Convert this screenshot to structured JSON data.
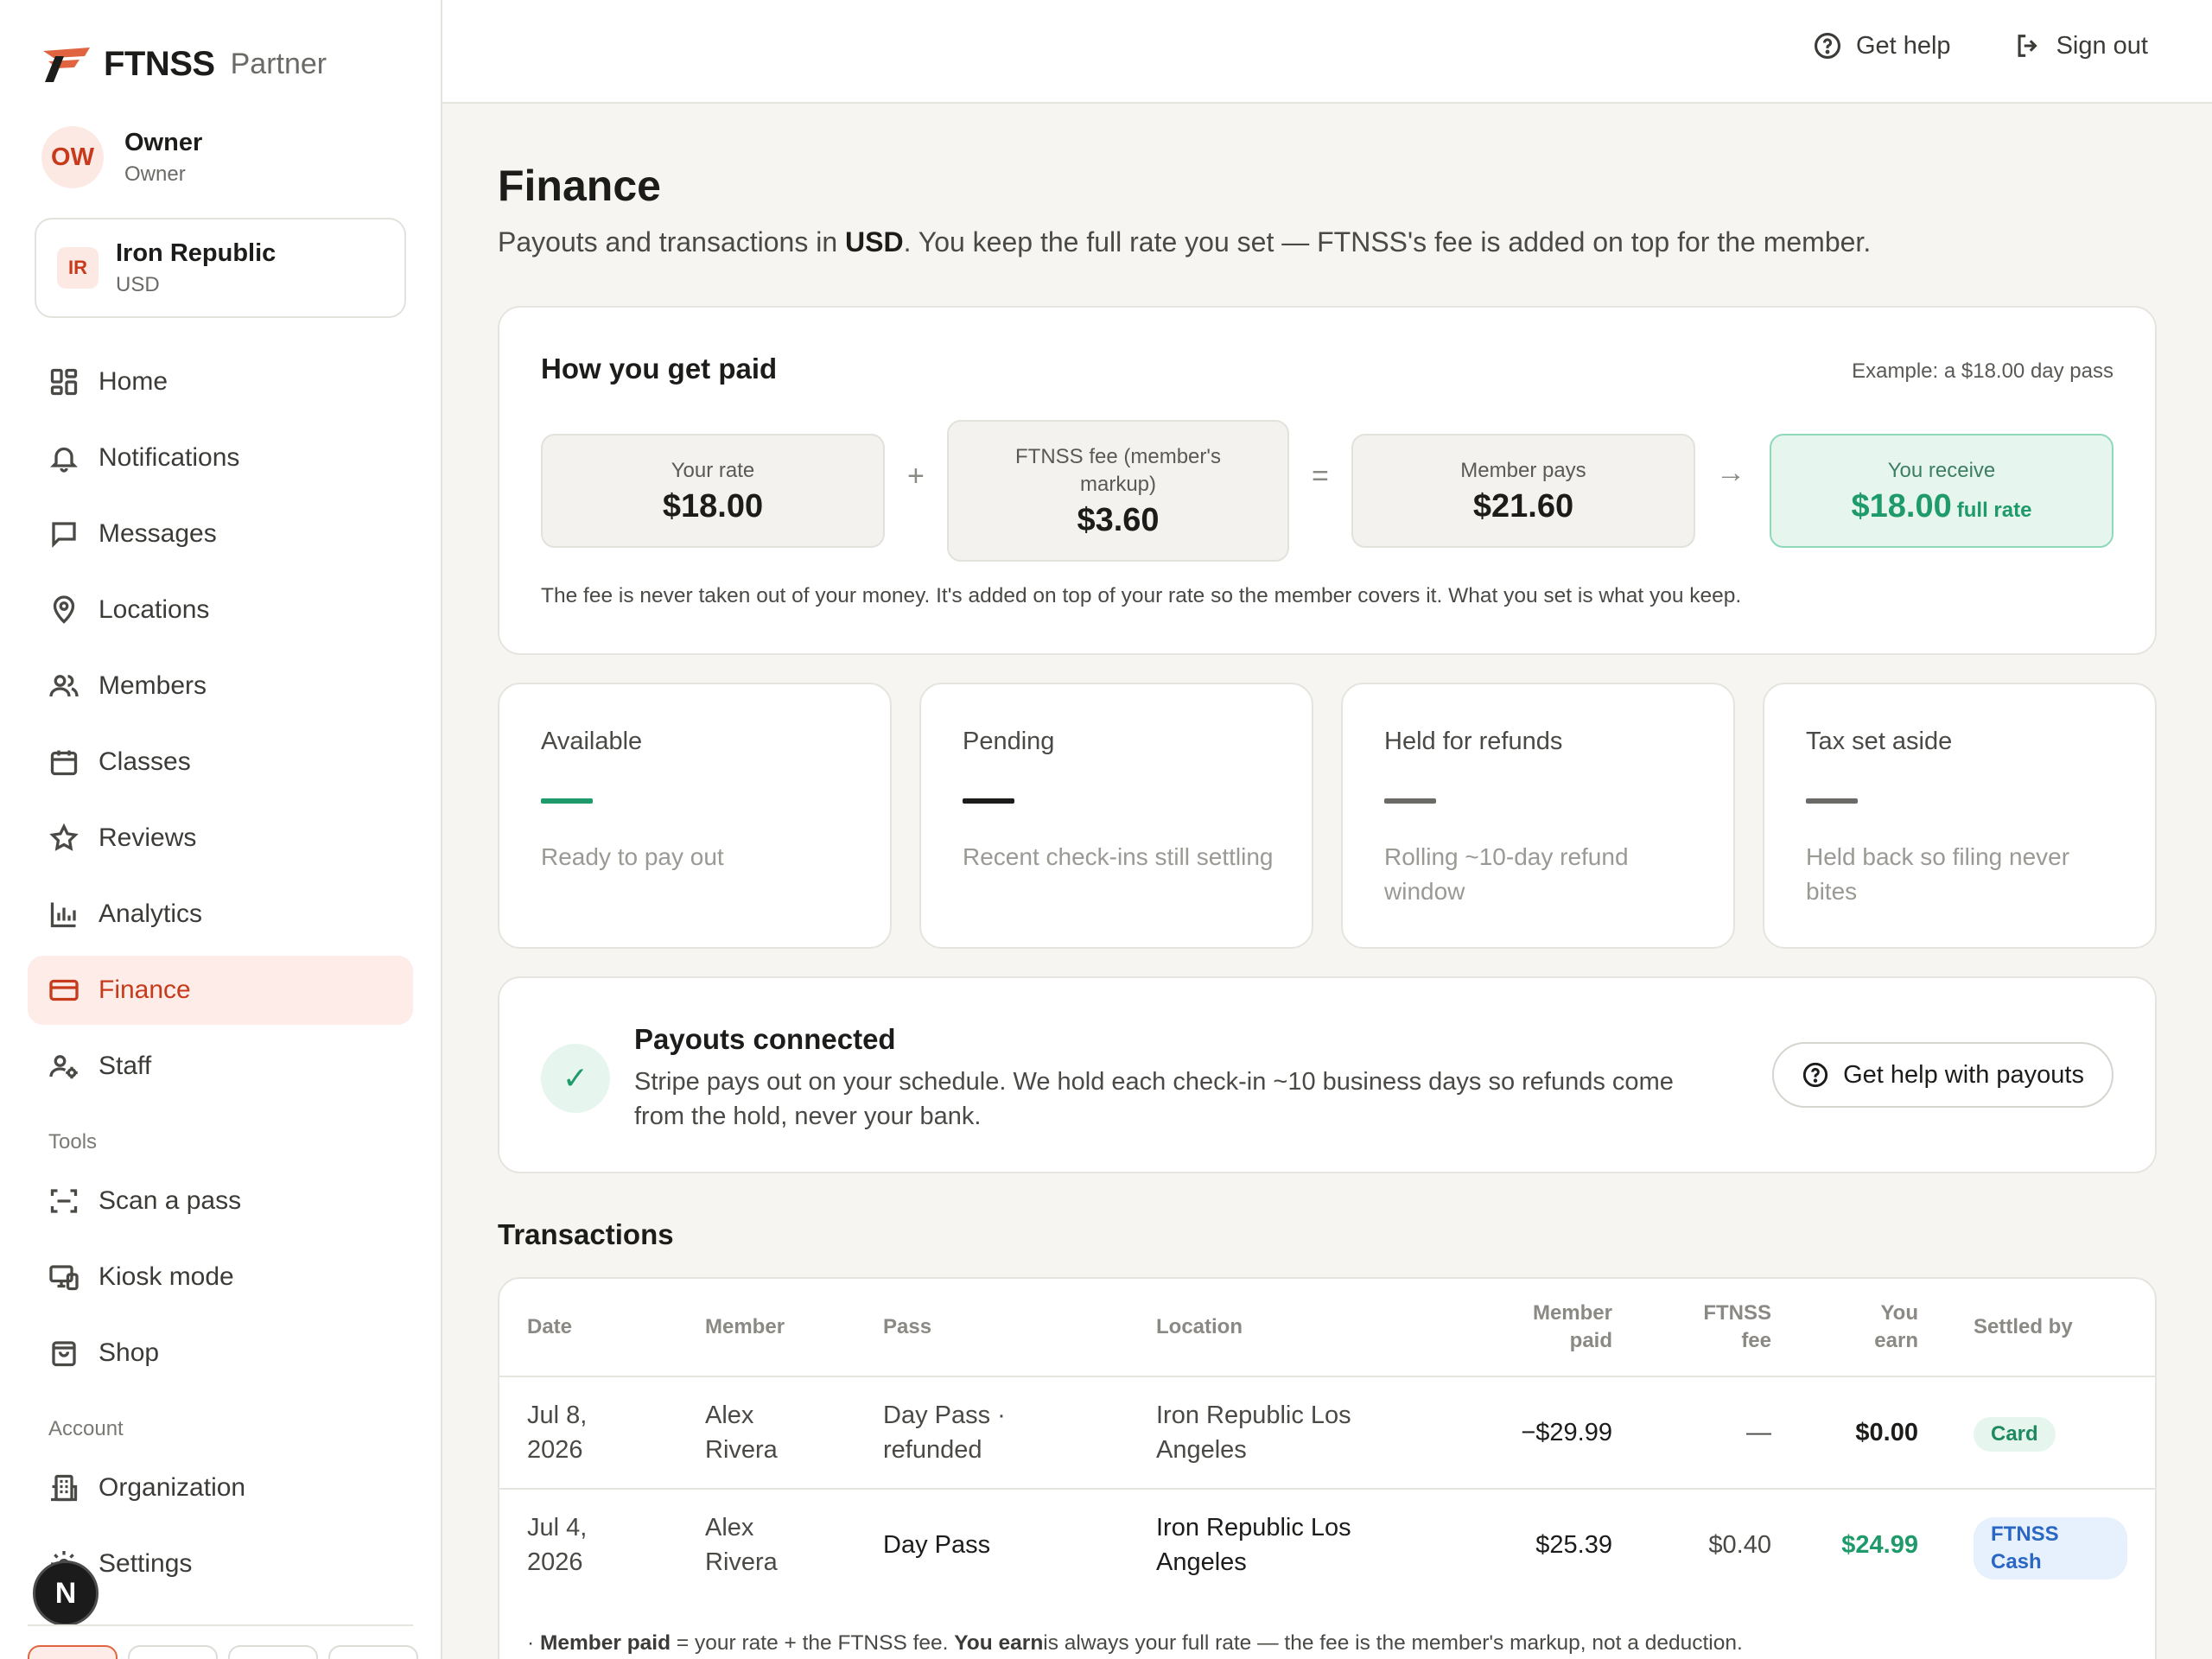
{
  "brand": {
    "name": "FTNSS",
    "sub": "Partner",
    "accent": "#e0643f"
  },
  "user": {
    "initials": "OW",
    "name": "Owner",
    "role": "Owner"
  },
  "org": {
    "initials": "IR",
    "name": "Iron Republic",
    "currency": "USD"
  },
  "nav": {
    "items": [
      {
        "label": "Home",
        "icon": "home-grid-icon"
      },
      {
        "label": "Notifications",
        "icon": "bell-icon"
      },
      {
        "label": "Messages",
        "icon": "message-icon"
      },
      {
        "label": "Locations",
        "icon": "map-pin-icon"
      },
      {
        "label": "Members",
        "icon": "users-icon"
      },
      {
        "label": "Classes",
        "icon": "calendar-icon"
      },
      {
        "label": "Reviews",
        "icon": "star-icon"
      },
      {
        "label": "Analytics",
        "icon": "bar-chart-icon"
      },
      {
        "label": "Finance",
        "icon": "credit-card-icon",
        "active": true
      },
      {
        "label": "Staff",
        "icon": "staff-gear-icon"
      }
    ],
    "tools_label": "Tools",
    "tools": [
      {
        "label": "Scan a pass",
        "icon": "scan-icon"
      },
      {
        "label": "Kiosk mode",
        "icon": "kiosk-icon"
      },
      {
        "label": "Shop",
        "icon": "shopping-bag-icon"
      }
    ],
    "account_label": "Account",
    "account": [
      {
        "label": "Organization",
        "icon": "building-icon"
      },
      {
        "label": "Settings",
        "icon": "settings-icon"
      }
    ],
    "badge": "N"
  },
  "topbar": {
    "help": "Get help",
    "signout": "Sign out"
  },
  "page": {
    "title": "Finance",
    "subtitle_pre": "Payouts and transactions in ",
    "subtitle_cur": "USD",
    "subtitle_post": ". You keep the full rate you set — FTNSS's fee is added on top for the member."
  },
  "how_paid": {
    "title": "How you get paid",
    "example": "Example: a $18.00 day pass",
    "rate_label": "Your rate",
    "rate_value": "$18.00",
    "plus": "+",
    "fee_label": "FTNSS fee (member's markup)",
    "fee_value": "$3.60",
    "equals": "=",
    "pays_label": "Member pays",
    "pays_value": "$21.60",
    "arrow": "→",
    "receive_label": "You receive",
    "receive_value": "$18.00",
    "receive_tag": "full rate",
    "note": "The fee is never taken out of your money. It's added on top of your rate so the member covers it. What you set is what you keep."
  },
  "stats": [
    {
      "label": "Available",
      "desc": "Ready to pay out",
      "color": "#1f9a6a"
    },
    {
      "label": "Pending",
      "desc": "Recent check-ins still settling",
      "color": "#1c1c1a"
    },
    {
      "label": "Held for refunds",
      "desc": "Rolling ~10-day refund window",
      "color": "#6b6a66"
    },
    {
      "label": "Tax set aside",
      "desc": "Held back so filing never bites",
      "color": "#6b6a66"
    }
  ],
  "payouts": {
    "check": "✓",
    "title": "Payouts connected",
    "desc": "Stripe pays out on your schedule. We hold each check-in ~10 business days so refunds come from the hold, never your bank.",
    "button": "Get help with payouts"
  },
  "transactions": {
    "title": "Transactions",
    "headers": [
      "Date",
      "Member",
      "Pass",
      "Location",
      "Member paid",
      "FTNSS fee",
      "You earn",
      "Settled by"
    ],
    "rows": [
      {
        "date": "Jul 8, 2026",
        "member": "Alex Rivera",
        "pass": "Day Pass · refunded",
        "location": "Iron Republic Los Angeles",
        "paid": "−$29.99",
        "fee": "—",
        "earn": "$0.00",
        "settled": "Card"
      },
      {
        "date": "Jul 4, 2026",
        "member": "Alex Rivera",
        "pass": "Day Pass",
        "location": "Iron Republic Los Angeles",
        "paid": "$25.39",
        "fee": "$0.40",
        "earn": "$24.99",
        "settled": "FTNSS Cash"
      }
    ],
    "foot_pre": "· ",
    "foot_b1": "Member paid",
    "foot_mid": " = your rate + the FTNSS fee. ",
    "foot_b2": "You earn",
    "foot_post": "is always your full rate — the fee is the member's markup, not a deduction."
  }
}
